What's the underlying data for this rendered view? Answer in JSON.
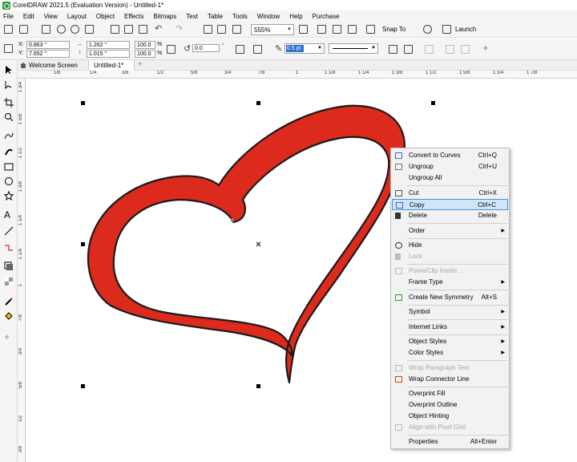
{
  "window": {
    "title": "CorelDRAW 2021.5 (Evaluation Version) - Untitled-1*"
  },
  "menubar": {
    "items": [
      "File",
      "Edit",
      "View",
      "Layout",
      "Object",
      "Effects",
      "Bitmaps",
      "Text",
      "Table",
      "Tools",
      "Window",
      "Help",
      "Purchase"
    ]
  },
  "toolbar": {
    "zoom": "555%",
    "snap_to": "Snap To",
    "launch": "Launch"
  },
  "propertybar": {
    "x": "0.863 \"",
    "y": "7.652 \"",
    "width": "1.262 \"",
    "height": "1.015 \"",
    "scale_w": "100.0",
    "scale_h": "100.0",
    "percent": "%",
    "angle": "0.0",
    "outline_width": "0.5 pt",
    "x_label": "X:",
    "y_label": "Y:"
  },
  "tabs": {
    "welcome": "Welcome Screen",
    "document": "Untitled-1*"
  },
  "ruler": {
    "h_labels": [
      "1/8",
      "1/4",
      "3/8",
      "1/2",
      "5/8",
      "3/4",
      "7/8",
      "1",
      "1 1/8",
      "1 1/4",
      "1 3/8",
      "1 1/2",
      "1 5/8",
      "1 3/4",
      "1 7/8"
    ],
    "v_labels": [
      "1 3/4",
      "1 5/8",
      "1 1/2",
      "1 3/8",
      "1 1/4",
      "1 1/8",
      "1",
      "7/8",
      "3/4",
      "5/8",
      "1/2",
      "3/8"
    ]
  },
  "context_menu": {
    "items": [
      {
        "label": "Convert to Curves",
        "shortcut": "Ctrl+Q",
        "icon": "convert-curves-icon"
      },
      {
        "label": "Ungroup",
        "shortcut": "Ctrl+U",
        "icon": "ungroup-icon"
      },
      {
        "label": "Ungroup All",
        "shortcut": "",
        "icon": ""
      },
      {
        "label": "Cut",
        "shortcut": "Ctrl+X",
        "icon": "cut-icon"
      },
      {
        "label": "Copy",
        "shortcut": "Ctrl+C",
        "icon": "copy-icon"
      },
      {
        "label": "Delete",
        "shortcut": "Delete",
        "icon": "trash-icon"
      },
      {
        "label": "Order",
        "shortcut": "",
        "icon": ""
      },
      {
        "label": "Hide",
        "shortcut": "",
        "icon": "eye-icon"
      },
      {
        "label": "Lock",
        "shortcut": "",
        "icon": "lock-icon"
      },
      {
        "label": "PowerClip Inside...",
        "shortcut": "",
        "icon": "powerclip-icon"
      },
      {
        "label": "Frame Type",
        "shortcut": "",
        "icon": ""
      },
      {
        "label": "Create New Symmetry",
        "shortcut": "Alt+S",
        "icon": "symmetry-icon"
      },
      {
        "label": "Symbol",
        "shortcut": "",
        "icon": ""
      },
      {
        "label": "Internet Links",
        "shortcut": "",
        "icon": ""
      },
      {
        "label": "Object Styles",
        "shortcut": "",
        "icon": ""
      },
      {
        "label": "Color Styles",
        "shortcut": "",
        "icon": ""
      },
      {
        "label": "Wrap Paragraph Text",
        "shortcut": "",
        "icon": "wrap-paragraph-icon"
      },
      {
        "label": "Wrap Connector Line",
        "shortcut": "",
        "icon": "wrap-connector-icon"
      },
      {
        "label": "Overprint Fill",
        "shortcut": "",
        "icon": ""
      },
      {
        "label": "Overprint Outline",
        "shortcut": "",
        "icon": ""
      },
      {
        "label": "Object Hinting",
        "shortcut": "",
        "icon": ""
      },
      {
        "label": "Align with Pixel Grid",
        "shortcut": "",
        "icon": "pixel-grid-icon"
      },
      {
        "label": "Properties",
        "shortcut": "Alt+Enter",
        "icon": ""
      }
    ]
  },
  "colors": {
    "heart_fill": "#dc2a1c",
    "heart_outline": "#1a1a1a",
    "highlight": "#cde6fa",
    "selection_blue": "#2f6fd0"
  }
}
